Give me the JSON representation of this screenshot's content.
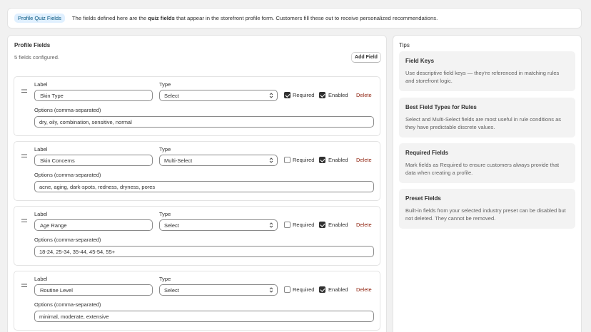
{
  "banner": {
    "badge": "Profile Quiz Fields",
    "text_before": "The fields defined here are the ",
    "text_bold": "quiz fields",
    "text_after": " that appear in the storefront profile form. Customers fill these out to receive personalized recommendations."
  },
  "profile_fields": {
    "title": "Profile Fields",
    "count": "5 fields configured.",
    "add_button": "Add Field",
    "label_caption": "Label",
    "type_caption": "Type",
    "required_caption": "Required",
    "enabled_caption": "Enabled",
    "delete_caption": "Delete",
    "options_caption": "Options (comma-separated)",
    "fields": [
      {
        "label": "Skin Type",
        "type": "Select",
        "required": true,
        "enabled": true,
        "options": "dry, oily, combination, sensitive, normal"
      },
      {
        "label": "Skin Concerns",
        "type": "Multi-Select",
        "required": false,
        "enabled": true,
        "options": "acne, aging, dark-spots, redness, dryness, pores"
      },
      {
        "label": "Age Range",
        "type": "Select",
        "required": false,
        "enabled": true,
        "options": "18-24, 25-34, 35-44, 45-54, 55+"
      },
      {
        "label": "Routine Level",
        "type": "Select",
        "required": false,
        "enabled": true,
        "options": "minimal, moderate, extensive"
      }
    ]
  },
  "tips": {
    "title": "Tips",
    "items": [
      {
        "title": "Field Keys",
        "body": "Use descriptive field keys — they're referenced in matching rules and storefront logic."
      },
      {
        "title": "Best Field Types for Rules",
        "body": "Select and Multi-Select fields are most useful in rule conditions as they have predictable discrete values."
      },
      {
        "title": "Required Fields",
        "body": "Mark fields as Required to ensure customers always provide that data when creating a profile."
      },
      {
        "title": "Preset Fields",
        "body": "Built-in fields from your selected industry preset can be disabled but not deleted. They cannot be removed."
      }
    ]
  },
  "icons": {
    "drag": "drag-handle-icon",
    "select_arrow": "chevron-up-down-icon",
    "check": "checkmark-icon"
  },
  "colors": {
    "badge_bg": "#e0f0ff",
    "badge_text": "#00527c",
    "delete": "#8e1f0b",
    "checked": "#303030"
  }
}
